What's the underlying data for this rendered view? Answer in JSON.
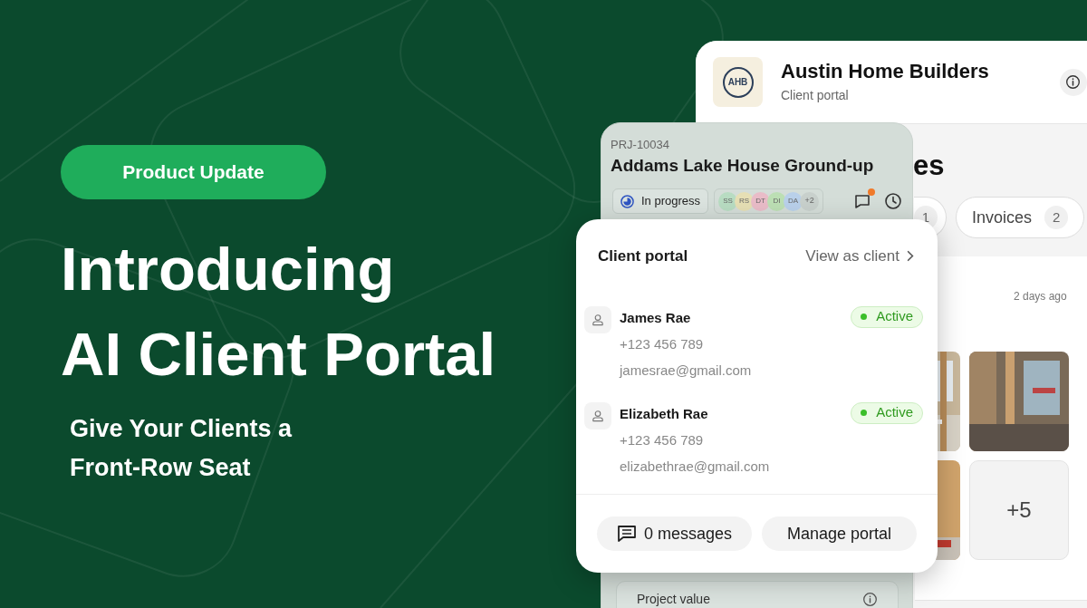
{
  "badge": "Product Update",
  "headline": [
    "Introducing",
    "AI Client Portal"
  ],
  "subheadline": [
    "Give Your Clients a",
    "Front-Row Seat"
  ],
  "builder_card": {
    "logo_text": "AHB",
    "company": "Austin Home Builders",
    "subtitle": "Client portal",
    "section_title": "es",
    "tabs": [
      {
        "count": "1"
      },
      {
        "label": "Invoices",
        "count": "2"
      }
    ],
    "update": {
      "time": "2 days ago",
      "more": "+5"
    }
  },
  "project_card": {
    "id": "PRJ-10034",
    "title": "Addams Lake House Ground-up",
    "status": "In progress",
    "avatars": [
      {
        "initials": "SS",
        "color": "#b8dcc2"
      },
      {
        "initials": "RS",
        "color": "#e6dfb4"
      },
      {
        "initials": "DT",
        "color": "#e9bcc8"
      },
      {
        "initials": "DI",
        "color": "#bcdfb4"
      },
      {
        "initials": "DA",
        "color": "#b9d0ea"
      }
    ],
    "avatar_more": "+2",
    "unread": true,
    "value_label": "Project value"
  },
  "portal_card": {
    "title": "Client portal",
    "link": "View as client",
    "clients": [
      {
        "name": "James Rae",
        "phone": "+123 456 789",
        "email": "jamesrae@gmail.com",
        "status": "Active",
        "kind": "active"
      },
      {
        "name": "Elizabeth Rae",
        "phone": "+123 456 789",
        "email": "elizabethrae@gmail.com",
        "status": "Active",
        "kind": "active"
      }
    ],
    "buttons": [
      {
        "label": "0 messages",
        "kind": "messages"
      },
      {
        "label": "Manage portal",
        "kind": "plain"
      }
    ]
  }
}
